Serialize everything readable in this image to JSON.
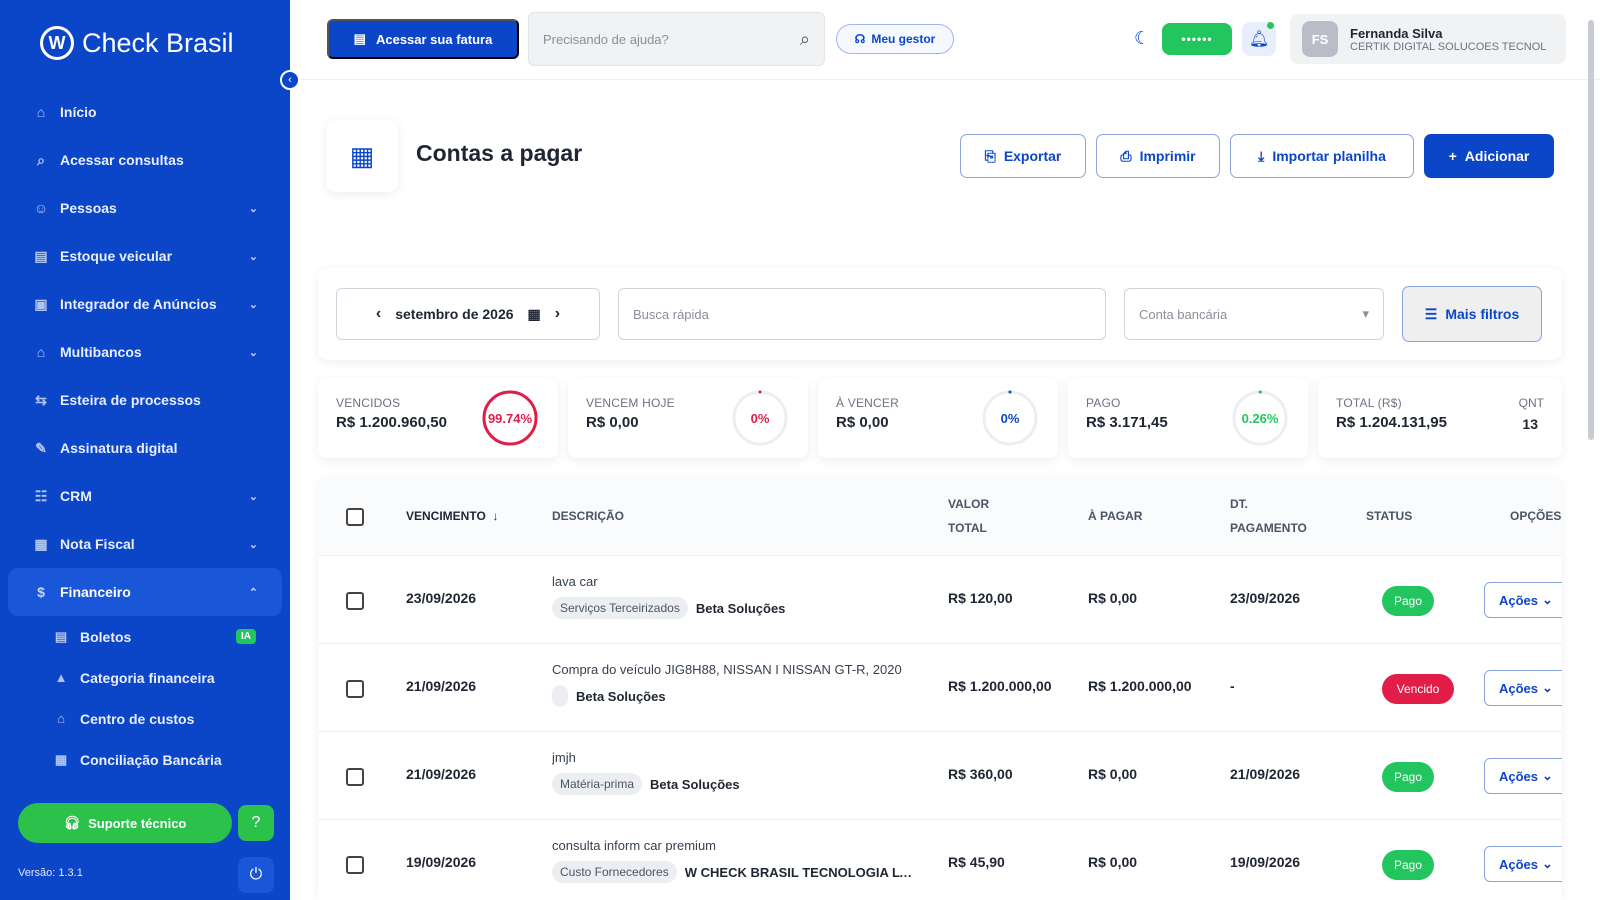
{
  "brand": {
    "name": "Check Brasil",
    "mark": "W"
  },
  "sidebar": {
    "items": [
      {
        "label": "Início",
        "icon": "home-icon",
        "glyph": "⌂",
        "chevron": ""
      },
      {
        "label": "Acessar consultas",
        "icon": "search-icon",
        "glyph": "⌕",
        "chevron": ""
      },
      {
        "label": "Pessoas",
        "icon": "people-icon",
        "glyph": "☺",
        "chevron": "⌄"
      },
      {
        "label": "Estoque veicular",
        "icon": "building-icon",
        "glyph": "▤",
        "chevron": "⌄"
      },
      {
        "label": "Integrador de Anúncios",
        "icon": "megaphone-icon",
        "glyph": "▣",
        "chevron": "⌄"
      },
      {
        "label": "Multibancos",
        "icon": "bank-icon",
        "glyph": "⌂",
        "chevron": "⌄"
      },
      {
        "label": "Esteira de processos",
        "icon": "flow-icon",
        "glyph": "⇆",
        "chevron": ""
      },
      {
        "label": "Assinatura digital",
        "icon": "signature-icon",
        "glyph": "✎",
        "chevron": ""
      },
      {
        "label": "CRM",
        "icon": "crm-icon",
        "glyph": "☷",
        "chevron": "⌄"
      },
      {
        "label": "Nota Fiscal",
        "icon": "invoice-icon",
        "glyph": "▦",
        "chevron": "⌄"
      },
      {
        "label": "Financeiro",
        "icon": "money-icon",
        "glyph": "$",
        "chevron": "⌃"
      }
    ],
    "sub_items": [
      {
        "label": "Boletos",
        "icon": "receipt-icon",
        "glyph": "▤",
        "badge": "IA"
      },
      {
        "label": "Categoria financeira",
        "icon": "shapes-icon",
        "glyph": "▲",
        "badge": ""
      },
      {
        "label": "Centro de custos",
        "icon": "bank-icon",
        "glyph": "⌂",
        "badge": ""
      },
      {
        "label": "Conciliação Bancária",
        "icon": "reconcile-icon",
        "glyph": "▦",
        "badge": ""
      }
    ],
    "support_label": "Suporte técnico",
    "version": "Versão: 1.3.1"
  },
  "topbar": {
    "fatura_label": "Acessar sua fatura",
    "help_placeholder": "Precisando de ajuda?",
    "gestor_label": "Meu gestor",
    "password_mask": "••••••",
    "user": {
      "initials": "FS",
      "name": "Fernanda Silva",
      "company": "CERTIK DIGITAL SOLUCOES TECNOLOGICAS"
    }
  },
  "page": {
    "title": "Contas a pagar",
    "buttons": {
      "export": "Exportar",
      "print": "Imprimir",
      "import": "Importar planilha",
      "add": "Adicionar"
    }
  },
  "filters": {
    "month": "setembro de 2026",
    "quick_search_placeholder": "Busca rápida",
    "bank_placeholder": "Conta bancária",
    "more_filters": "Mais filtros"
  },
  "summary": [
    {
      "label": "VENCIDOS",
      "value": "R$ 1.200.960,50",
      "percent": "99.74%",
      "fraction": 0.9974,
      "color": "#e11d48"
    },
    {
      "label": "VENCEM HOJE",
      "value": "R$ 0,00",
      "percent": "0%",
      "fraction": 0,
      "color": "#e11d48"
    },
    {
      "label": "À VENCER",
      "value": "R$ 0,00",
      "percent": "0%",
      "fraction": 0,
      "color": "#0b46c9"
    },
    {
      "label": "PAGO",
      "value": "R$ 3.171,45",
      "percent": "0.26%",
      "fraction": 0.0026,
      "color": "#22c55e"
    }
  ],
  "total": {
    "label": "TOTAL (R$)",
    "value": "R$ 1.204.131,95",
    "qnt_label": "QNT",
    "qnt_value": "13"
  },
  "table": {
    "headers": {
      "vencimento": "VENCIMENTO",
      "descricao": "DESCRIÇÃO",
      "valor_total_1": "VALOR",
      "valor_total_2": "TOTAL",
      "a_pagar": "À PAGAR",
      "dt_pagamento_1": "DT.",
      "dt_pagamento_2": "PAGAMENTO",
      "status": "STATUS",
      "opcoes": "OPÇÕES"
    },
    "actions_label": "Ações",
    "rows": [
      {
        "vencimento": "23/09/2026",
        "descricao": "lava car",
        "tag": "Serviços Terceirizados",
        "supplier": "Beta Soluções",
        "valor_total": "R$ 120,00",
        "a_pagar": "R$ 0,00",
        "dt_pagamento": "23/09/2026",
        "status": "Pago",
        "status_color": "#22c55e"
      },
      {
        "vencimento": "21/09/2026",
        "descricao": "Compra do veículo JIG8H88, NISSAN I NISSAN GT-R, 2020",
        "tag": "",
        "supplier": "Beta Soluções",
        "valor_total": "R$ 1.200.000,00",
        "a_pagar": "R$ 1.200.000,00",
        "dt_pagamento": "-",
        "status": "Vencido",
        "status_color": "#e11d48"
      },
      {
        "vencimento": "21/09/2026",
        "descricao": "jmjh",
        "tag": "Matéria-prima",
        "supplier": "Beta Soluções",
        "valor_total": "R$ 360,00",
        "a_pagar": "R$ 0,00",
        "dt_pagamento": "21/09/2026",
        "status": "Pago",
        "status_color": "#22c55e"
      },
      {
        "vencimento": "19/09/2026",
        "descricao": "consulta inform car premium",
        "tag": "Custo Fornecedores",
        "supplier": "W CHECK BRASIL TECNOLOGIA LTDA",
        "valor_total": "R$ 45,90",
        "a_pagar": "R$ 0,00",
        "dt_pagamento": "19/09/2026",
        "status": "Pago",
        "status_color": "#22c55e"
      }
    ]
  }
}
